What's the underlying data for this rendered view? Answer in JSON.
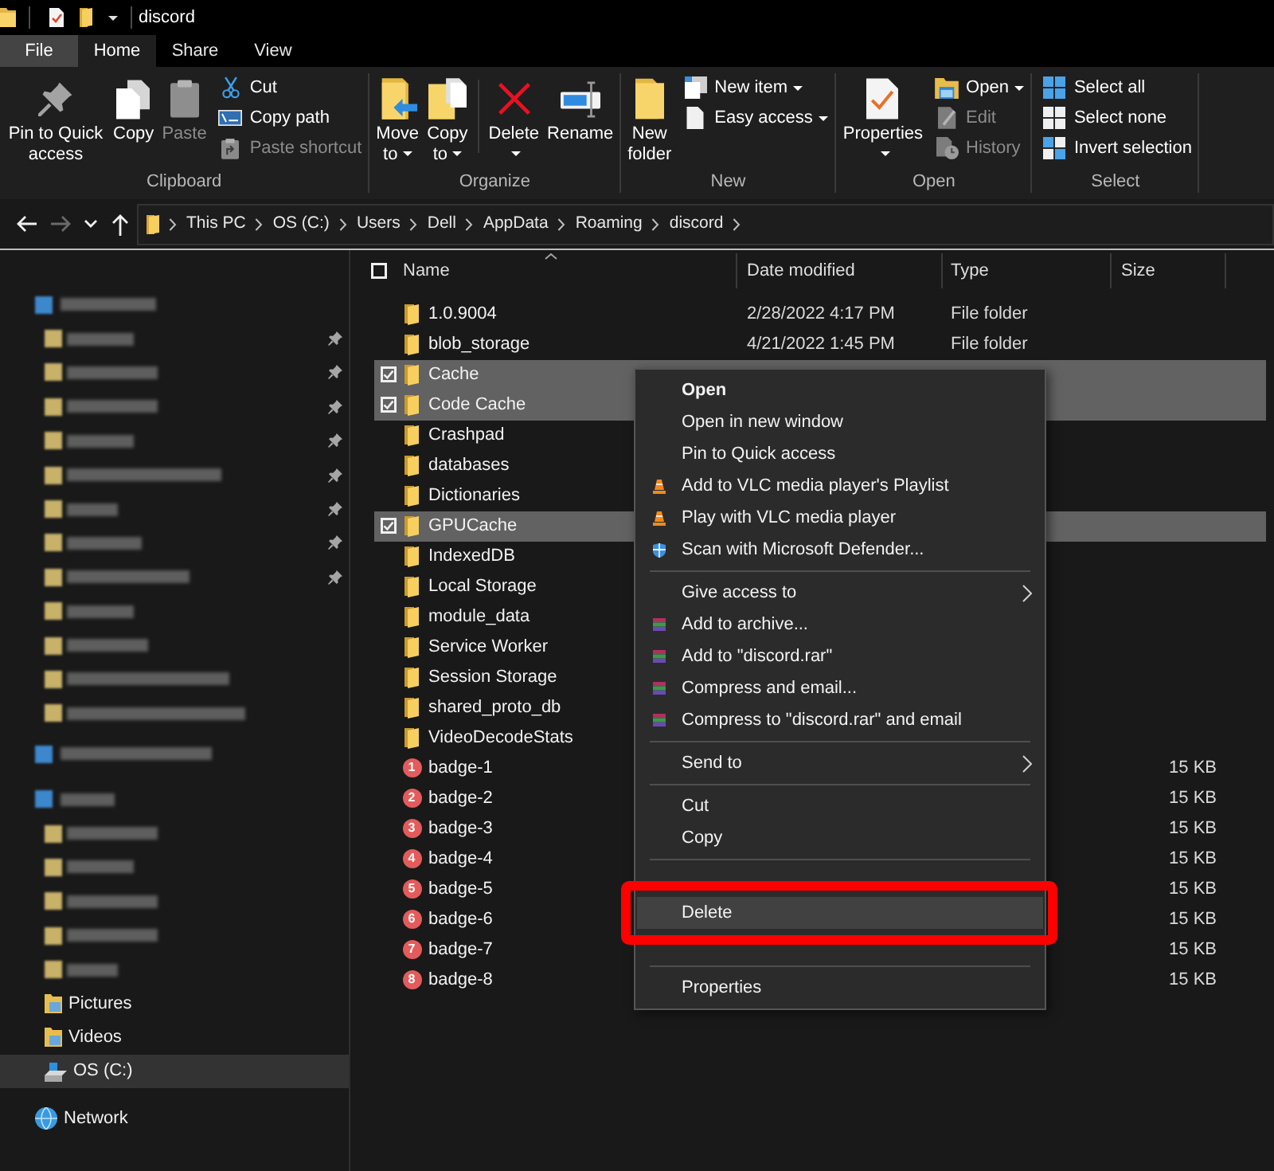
{
  "window": {
    "title": "discord"
  },
  "ribbon": {
    "tabs": [
      {
        "label": "File",
        "kind": "file",
        "selected": false
      },
      {
        "label": "Home",
        "kind": "tab",
        "selected": true
      },
      {
        "label": "Share",
        "kind": "tab",
        "selected": false
      },
      {
        "label": "View",
        "kind": "tab",
        "selected": false
      }
    ],
    "groups": [
      {
        "label": "Clipboard",
        "items": [
          {
            "kind": "large",
            "label": "Pin to Quick access",
            "disabled": false,
            "dropdown": false
          },
          {
            "kind": "large",
            "label": "Copy",
            "disabled": false,
            "dropdown": false
          },
          {
            "kind": "large",
            "label": "Paste",
            "disabled": true,
            "dropdown": false
          },
          {
            "kind": "stack",
            "buttons": [
              {
                "label": "Cut",
                "disabled": false,
                "dropdown": false
              },
              {
                "label": "Copy path",
                "disabled": false,
                "dropdown": false
              },
              {
                "label": "Paste shortcut",
                "disabled": true,
                "dropdown": false
              }
            ]
          }
        ]
      },
      {
        "label": "Organize",
        "items": [
          {
            "kind": "large",
            "label": "Move to",
            "disabled": false,
            "dropdown": true
          },
          {
            "kind": "large",
            "label": "Copy to",
            "disabled": false,
            "dropdown": true
          },
          {
            "kind": "large",
            "label": "Delete",
            "disabled": false,
            "dropdown": true
          },
          {
            "kind": "large",
            "label": "Rename",
            "disabled": false,
            "dropdown": false
          }
        ]
      },
      {
        "label": "New",
        "items": [
          {
            "kind": "large",
            "label": "New folder",
            "disabled": false,
            "dropdown": false
          },
          {
            "kind": "stack",
            "buttons": [
              {
                "label": "New item",
                "disabled": false,
                "dropdown": true
              },
              {
                "label": "Easy access",
                "disabled": false,
                "dropdown": true
              }
            ]
          }
        ]
      },
      {
        "label": "Open",
        "items": [
          {
            "kind": "large",
            "label": "Properties",
            "disabled": false,
            "dropdown": true
          },
          {
            "kind": "stack",
            "buttons": [
              {
                "label": "Open",
                "disabled": false,
                "dropdown": true
              },
              {
                "label": "Edit",
                "disabled": true,
                "dropdown": false
              },
              {
                "label": "History",
                "disabled": true,
                "dropdown": false
              }
            ]
          }
        ]
      },
      {
        "label": "Select",
        "items": [
          {
            "kind": "stack",
            "buttons": [
              {
                "label": "Select all",
                "disabled": false,
                "dropdown": false
              },
              {
                "label": "Select none",
                "disabled": false,
                "dropdown": false
              },
              {
                "label": "Invert selection",
                "disabled": false,
                "dropdown": false
              }
            ]
          }
        ]
      }
    ]
  },
  "address": {
    "nav": [
      {
        "disabled": false
      },
      {
        "disabled": true
      },
      {
        "disabled": false
      },
      {
        "disabled": false
      }
    ],
    "path": [
      "This PC",
      "OS (C:)",
      "Users",
      "Dell",
      "AppData",
      "Roaming",
      "discord"
    ]
  },
  "nav_pane": {
    "items": [
      {
        "kind": "blurred",
        "selected": false,
        "children": [
          {
            "kind": "blurred",
            "pinned": true,
            "selected": false
          },
          {
            "kind": "blurred",
            "pinned": true,
            "selected": false
          },
          {
            "kind": "blurred",
            "pinned": true,
            "selected": false
          },
          {
            "kind": "blurred",
            "pinned": true,
            "selected": false
          },
          {
            "kind": "blurred",
            "pinned": true,
            "selected": false
          },
          {
            "kind": "blurred",
            "pinned": true,
            "selected": false
          },
          {
            "kind": "blurred",
            "pinned": true,
            "selected": false
          },
          {
            "kind": "blurred",
            "pinned": true,
            "selected": false
          },
          {
            "kind": "blurred",
            "pinned": false,
            "selected": false
          },
          {
            "kind": "blurred",
            "pinned": false,
            "selected": false
          },
          {
            "kind": "blurred",
            "pinned": false,
            "selected": false
          },
          {
            "kind": "blurred",
            "pinned": false,
            "selected": false
          }
        ]
      },
      {
        "kind": "blurred",
        "selected": false
      },
      {
        "kind": "blurred",
        "selected": false,
        "children": [
          {
            "kind": "blurred",
            "pinned": false,
            "selected": false
          },
          {
            "kind": "blurred",
            "pinned": false,
            "selected": false
          },
          {
            "kind": "blurred",
            "pinned": false,
            "selected": false
          },
          {
            "kind": "blurred",
            "pinned": false,
            "selected": false
          },
          {
            "kind": "blurred",
            "pinned": false,
            "selected": false
          },
          {
            "kind": "folder",
            "label": "Pictures",
            "pinned": false,
            "selected": false
          },
          {
            "kind": "folder",
            "label": "Videos",
            "pinned": false,
            "selected": false
          },
          {
            "kind": "drive",
            "label": "OS (C:)",
            "pinned": false,
            "selected": true
          }
        ]
      },
      {
        "kind": "network",
        "label": "Network",
        "selected": false
      }
    ]
  },
  "table": {
    "select_all_checked": false,
    "columns": [
      {
        "label": "Name",
        "sorted": true
      },
      {
        "label": "Date modified",
        "sorted": false
      },
      {
        "label": "Type",
        "sorted": false
      },
      {
        "label": "Size",
        "sorted": false
      }
    ],
    "rows": [
      {
        "kind": "folder",
        "name": "1.0.9004",
        "date": "2/28/2022 4:17 PM",
        "type": "File folder",
        "selected": false
      },
      {
        "kind": "folder",
        "name": "blob_storage",
        "date": "4/21/2022 1:45 PM",
        "type": "File folder",
        "selected": false
      },
      {
        "kind": "folder",
        "name": "Cache",
        "selected": true
      },
      {
        "kind": "folder",
        "name": "Code Cache",
        "selected": true
      },
      {
        "kind": "folder",
        "name": "Crashpad",
        "selected": false
      },
      {
        "kind": "folder",
        "name": "databases",
        "selected": false
      },
      {
        "kind": "folder",
        "name": "Dictionaries",
        "selected": false
      },
      {
        "kind": "folder",
        "name": "GPUCache",
        "selected": true
      },
      {
        "kind": "folder",
        "name": "IndexedDB",
        "selected": false
      },
      {
        "kind": "folder",
        "name": "Local Storage",
        "selected": false
      },
      {
        "kind": "folder",
        "name": "module_data",
        "selected": false
      },
      {
        "kind": "folder",
        "name": "Service Worker",
        "selected": false
      },
      {
        "kind": "folder",
        "name": "Session Storage",
        "selected": false
      },
      {
        "kind": "folder",
        "name": "shared_proto_db",
        "selected": false
      },
      {
        "kind": "folder",
        "name": "VideoDecodeStats",
        "selected": false
      },
      {
        "kind": "image",
        "name": "badge-1",
        "thumbnail_text": "1",
        "size": "15 KB",
        "selected": false
      },
      {
        "kind": "image",
        "name": "badge-2",
        "thumbnail_text": "2",
        "size": "15 KB",
        "selected": false
      },
      {
        "kind": "image",
        "name": "badge-3",
        "thumbnail_text": "3",
        "size": "15 KB",
        "selected": false
      },
      {
        "kind": "image",
        "name": "badge-4",
        "thumbnail_text": "4",
        "size": "15 KB",
        "selected": false
      },
      {
        "kind": "image",
        "name": "badge-5",
        "thumbnail_text": "5",
        "size": "15 KB",
        "selected": false
      },
      {
        "kind": "image",
        "name": "badge-6",
        "thumbnail_text": "6",
        "size": "15 KB",
        "selected": false
      },
      {
        "kind": "image",
        "name": "badge-7",
        "thumbnail_text": "7",
        "size": "15 KB",
        "selected": false
      },
      {
        "kind": "image",
        "name": "badge-8",
        "thumbnail_text": "8",
        "size": "15 KB",
        "selected": false
      }
    ]
  },
  "context_menu": {
    "highlight_frame": true,
    "items": [
      {
        "kind": "item",
        "label": "Open",
        "default": true,
        "submenu": false,
        "selected": false
      },
      {
        "kind": "item",
        "label": "Open in new window",
        "default": false,
        "submenu": false,
        "selected": false
      },
      {
        "kind": "item",
        "label": "Pin to Quick access",
        "default": false,
        "submenu": false,
        "selected": false
      },
      {
        "kind": "item",
        "label": "Add to VLC media player's Playlist",
        "default": false,
        "submenu": false,
        "selected": false
      },
      {
        "kind": "item",
        "label": "Play with VLC media player",
        "default": false,
        "submenu": false,
        "selected": false
      },
      {
        "kind": "item",
        "label": "Scan with Microsoft Defender...",
        "default": false,
        "submenu": false,
        "selected": false
      },
      {
        "kind": "separator"
      },
      {
        "kind": "item",
        "label": "Give access to",
        "default": false,
        "submenu": true,
        "selected": false
      },
      {
        "kind": "item",
        "label": "Add to archive...",
        "default": false,
        "submenu": false,
        "selected": false
      },
      {
        "kind": "item",
        "label": "Add to \"discord.rar\"",
        "default": false,
        "submenu": false,
        "selected": false
      },
      {
        "kind": "item",
        "label": "Compress and email...",
        "default": false,
        "submenu": false,
        "selected": false
      },
      {
        "kind": "item",
        "label": "Compress to \"discord.rar\" and email",
        "default": false,
        "submenu": false,
        "selected": false
      },
      {
        "kind": "separator"
      },
      {
        "kind": "item",
        "label": "Send to",
        "default": false,
        "submenu": true,
        "selected": false
      },
      {
        "kind": "separator"
      },
      {
        "kind": "item",
        "label": "Cut",
        "default": false,
        "submenu": false,
        "selected": false
      },
      {
        "kind": "item",
        "label": "Copy",
        "default": false,
        "submenu": false,
        "selected": false
      },
      {
        "kind": "separator"
      },
      {
        "kind": "covered"
      },
      {
        "kind": "item",
        "label": "Delete",
        "default": false,
        "submenu": false,
        "selected": true
      },
      {
        "kind": "covered"
      },
      {
        "kind": "separator"
      },
      {
        "kind": "item",
        "label": "Properties",
        "default": false,
        "submenu": false,
        "selected": false
      }
    ]
  }
}
